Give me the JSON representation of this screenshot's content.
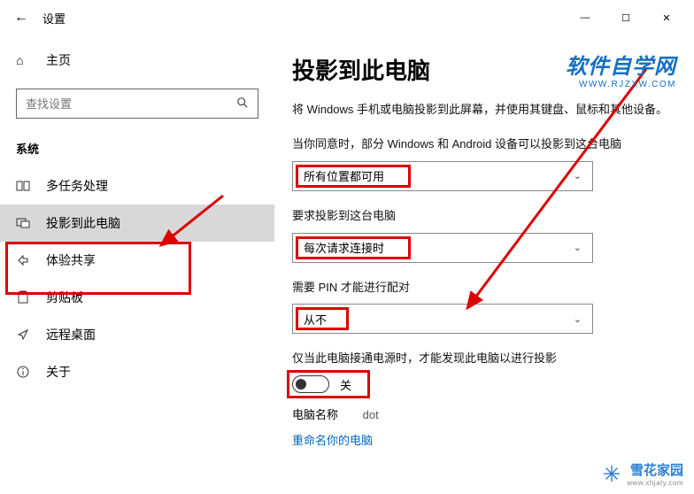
{
  "window": {
    "title": "设置",
    "min": "—",
    "max": "☐",
    "close": "✕"
  },
  "sidebar": {
    "home_label": "主页",
    "search_placeholder": "查找设置",
    "group_label": "系统",
    "items": [
      {
        "label": "多任务处理",
        "icon": "multitask"
      },
      {
        "label": "投影到此电脑",
        "icon": "project",
        "active": true
      },
      {
        "label": "体验共享",
        "icon": "share"
      },
      {
        "label": "剪贴板",
        "icon": "clipboard"
      },
      {
        "label": "远程桌面",
        "icon": "remote"
      },
      {
        "label": "关于",
        "icon": "info"
      }
    ]
  },
  "page": {
    "title": "投影到此电脑",
    "desc": "将 Windows 手机或电脑投影到此屏幕，并使用其键盘、鼠标和其他设备。",
    "field1_label": "当你同意时，部分 Windows 和 Android 设备可以投影到这台电脑",
    "field1_value": "所有位置都可用",
    "field2_label": "要求投影到这台电脑",
    "field2_value": "每次请求连接时",
    "field3_label": "需要 PIN 才能进行配对",
    "field3_value": "从不",
    "toggle_label": "仅当此电脑接通电源时，才能发现此电脑以进行投影",
    "toggle_state": "关",
    "pc_name_label": "电脑名称",
    "pc_name_value": "dot",
    "rename_link": "重命名你的电脑"
  },
  "brand1": {
    "cn": "软件自学网",
    "en": "WWW.RJZXW.COM"
  },
  "brand2": {
    "cn": "雪花家园",
    "en": "www.xhjaty.com"
  },
  "annotations": {
    "redbox_widths": {
      "field1": 130,
      "field2": 130,
      "field3": 60,
      "toggle": 94
    }
  }
}
